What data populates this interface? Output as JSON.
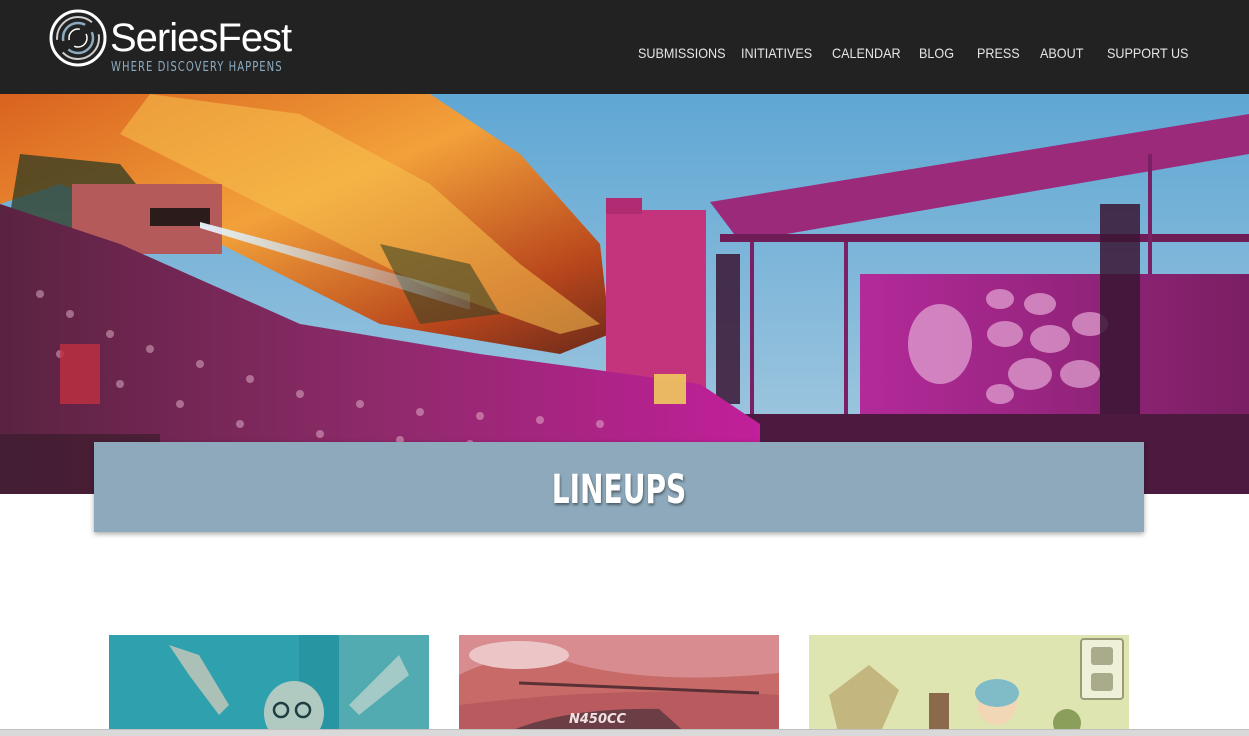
{
  "brand": {
    "name": "SeriesFest",
    "tagline": "WHERE DISCOVERY HAPPENS"
  },
  "nav": {
    "items": [
      {
        "label": "SUBMISSIONS"
      },
      {
        "label": "INITIATIVES"
      },
      {
        "label": "CALENDAR"
      },
      {
        "label": "BLOG"
      },
      {
        "label": "PRESS"
      },
      {
        "label": "ABOUT"
      },
      {
        "label": "SUPPORT US"
      }
    ]
  },
  "page": {
    "title": "LINEUPS"
  },
  "cards": [
    {
      "overlay_color": "#2fa3a8"
    },
    {
      "overlay_color": "#d56a78",
      "plate_text": "N450CC"
    },
    {
      "overlay_color": "#c8d98a"
    }
  ],
  "colors": {
    "header_bg": "#222222",
    "tagline": "#8cabc1",
    "banner_bg": "#8da9bb"
  }
}
